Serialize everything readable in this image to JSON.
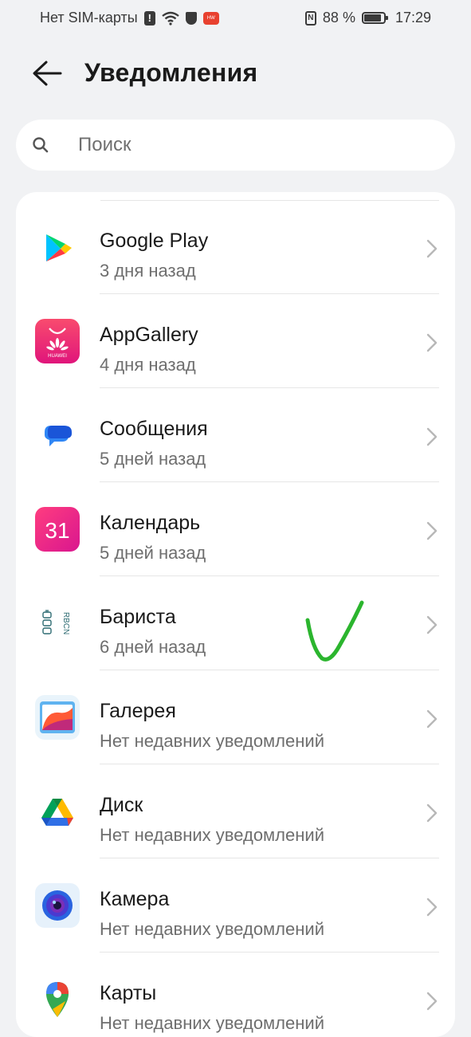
{
  "status_bar": {
    "carrier": "Нет SIM-карты",
    "battery_percent": "88 %",
    "battery_level": 0.88,
    "time": "17:29",
    "icons": [
      "sim-alert-icon",
      "wifi-icon",
      "shield-icon",
      "huawei-badge-icon",
      "nfc-icon",
      "battery-icon"
    ]
  },
  "header": {
    "title": "Уведомления",
    "back_icon": "arrow-left-icon"
  },
  "search": {
    "placeholder": "Поиск",
    "value": ""
  },
  "apps": [
    {
      "name": "Google Play",
      "subtitle": "3 дня назад",
      "icon": "google-play-icon"
    },
    {
      "name": "AppGallery",
      "subtitle": "4 дня назад",
      "icon": "appgallery-icon"
    },
    {
      "name": "Сообщения",
      "subtitle": "5 дней назад",
      "icon": "messages-icon"
    },
    {
      "name": "Календарь",
      "subtitle": "5 дней назад",
      "icon": "calendar-icon",
      "icon_text": "31"
    },
    {
      "name": "Бариста",
      "subtitle": "6 дней назад",
      "icon": "barista-icon",
      "icon_text": "RBCN"
    },
    {
      "name": "Галерея",
      "subtitle": "Нет недавних уведомлений",
      "icon": "gallery-icon"
    },
    {
      "name": "Диск",
      "subtitle": "Нет недавних уведомлений",
      "icon": "drive-icon"
    },
    {
      "name": "Камера",
      "subtitle": "Нет недавних уведомлений",
      "icon": "camera-icon"
    },
    {
      "name": "Карты",
      "subtitle": "Нет недавних уведомлений",
      "icon": "maps-icon"
    }
  ],
  "colors": {
    "background": "#f1f2f4",
    "card": "#ffffff",
    "annotation_green": "#2bb52e"
  }
}
